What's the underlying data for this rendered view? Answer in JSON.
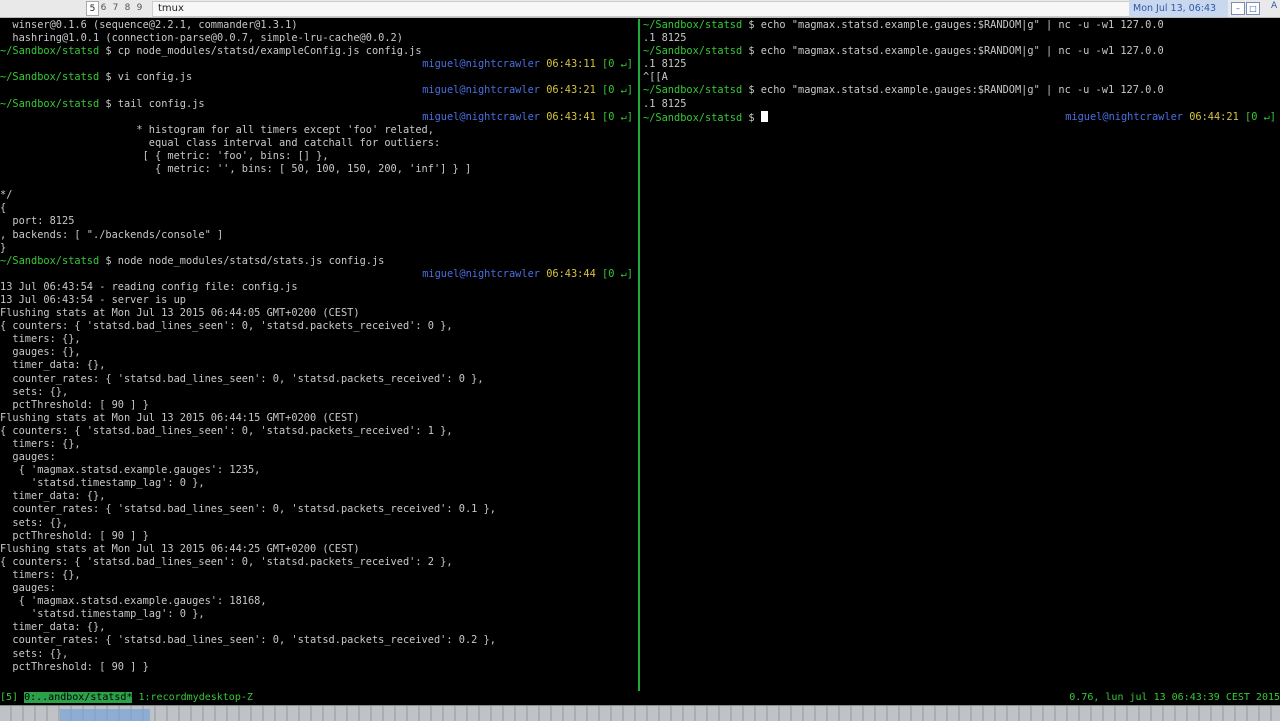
{
  "topbar": {
    "workspaces": [
      "5",
      "6",
      "7",
      "8",
      "9"
    ],
    "window_title": "tmux",
    "clock": "Mon Jul 13, 06:43",
    "trailing": "A"
  },
  "left_pane": [
    {
      "t": "  winser@0.1.6 (sequence@2.2.1, commander@1.3.1)"
    },
    {
      "t": "  hashring@1.0.1 (connection-parse@0.0.7, simple-lru-cache@0.0.2)"
    },
    {
      "cwd": "~/Sandbox/statsd",
      "t": " $ cp node_modules/statsd/exampleConfig.js config.js"
    },
    {
      "t": "",
      "user": "miguel@nightcrawler",
      "time": "06:43:11",
      "stat": "[0 ↵]"
    },
    {
      "cwd": "~/Sandbox/statsd",
      "t": " $ vi config.js"
    },
    {
      "t": "",
      "user": "miguel@nightcrawler",
      "time": "06:43:21",
      "stat": "[0 ↵]"
    },
    {
      "cwd": "~/Sandbox/statsd",
      "t": " $ tail config.js"
    },
    {
      "t": "",
      "user": "miguel@nightcrawler",
      "time": "06:43:41",
      "stat": "[0 ↵]"
    },
    {
      "t": "                      * histogram for all timers except 'foo' related,"
    },
    {
      "t": "                        equal class interval and catchall for outliers:"
    },
    {
      "t": "                       [ { metric: 'foo', bins: [] },"
    },
    {
      "t": "                         { metric: '', bins: [ 50, 100, 150, 200, 'inf'] } ]"
    },
    {
      "t": ""
    },
    {
      "t": "*/"
    },
    {
      "t": "{"
    },
    {
      "t": "  port: 8125"
    },
    {
      "t": ", backends: [ \"./backends/console\" ]"
    },
    {
      "t": "}"
    },
    {
      "cwd": "~/Sandbox/statsd",
      "t": " $ node node_modules/statsd/stats.js config.js"
    },
    {
      "t": "",
      "user": "miguel@nightcrawler",
      "time": "06:43:44",
      "stat": "[0 ↵]"
    },
    {
      "t": "13 Jul 06:43:54 - reading config file: config.js"
    },
    {
      "t": "13 Jul 06:43:54 - server is up"
    },
    {
      "t": "Flushing stats at Mon Jul 13 2015 06:44:05 GMT+0200 (CEST)"
    },
    {
      "t": "{ counters: { 'statsd.bad_lines_seen': 0, 'statsd.packets_received': 0 },"
    },
    {
      "t": "  timers: {},"
    },
    {
      "t": "  gauges: {},"
    },
    {
      "t": "  timer_data: {},"
    },
    {
      "t": "  counter_rates: { 'statsd.bad_lines_seen': 0, 'statsd.packets_received': 0 },"
    },
    {
      "t": "  sets: {},"
    },
    {
      "t": "  pctThreshold: [ 90 ] }"
    },
    {
      "t": "Flushing stats at Mon Jul 13 2015 06:44:15 GMT+0200 (CEST)"
    },
    {
      "t": "{ counters: { 'statsd.bad_lines_seen': 0, 'statsd.packets_received': 1 },"
    },
    {
      "t": "  timers: {},"
    },
    {
      "t": "  gauges:"
    },
    {
      "t": "   { 'magmax.statsd.example.gauges': 1235,"
    },
    {
      "t": "     'statsd.timestamp_lag': 0 },"
    },
    {
      "t": "  timer_data: {},"
    },
    {
      "t": "  counter_rates: { 'statsd.bad_lines_seen': 0, 'statsd.packets_received': 0.1 },"
    },
    {
      "t": "  sets: {},"
    },
    {
      "t": "  pctThreshold: [ 90 ] }"
    },
    {
      "t": "Flushing stats at Mon Jul 13 2015 06:44:25 GMT+0200 (CEST)"
    },
    {
      "t": "{ counters: { 'statsd.bad_lines_seen': 0, 'statsd.packets_received': 2 },"
    },
    {
      "t": "  timers: {},"
    },
    {
      "t": "  gauges:"
    },
    {
      "t": "   { 'magmax.statsd.example.gauges': 18168,"
    },
    {
      "t": "     'statsd.timestamp_lag': 0 },"
    },
    {
      "t": "  timer_data: {},"
    },
    {
      "t": "  counter_rates: { 'statsd.bad_lines_seen': 0, 'statsd.packets_received': 0.2 },"
    },
    {
      "t": "  sets: {},"
    },
    {
      "t": "  pctThreshold: [ 90 ] }"
    }
  ],
  "right_pane": [
    {
      "cwd": "~/Sandbox/statsd",
      "t": " $ echo \"magmax.statsd.example.gauges:$RANDOM|g\" | nc -u -w1 127.0.0"
    },
    {
      "t": ".1 8125"
    },
    {
      "cwd": "~/Sandbox/statsd",
      "t": " $ echo \"magmax.statsd.example.gauges:$RANDOM|g\" | nc -u -w1 127.0.0"
    },
    {
      "t": ".1 8125"
    },
    {
      "t": "^[[A"
    },
    {
      "cwd": "~/Sandbox/statsd",
      "t": " $ echo \"magmax.statsd.example.gauges:$RANDOM|g\" | nc -u -w1 127.0.0"
    },
    {
      "t": ".1 8125"
    },
    {
      "cwd": "~/Sandbox/statsd",
      "t": " $ ",
      "cursor": true,
      "user": "miguel@nightcrawler",
      "time": "06:44:21",
      "stat": "[0 ↵]"
    }
  ],
  "statusbar": {
    "session": "[5] ",
    "active_window": "0:..andbox/statsd*",
    "other_window": " 1:recordmydesktop-Z",
    "right": "0.76, lun jul 13 06:43:39 CEST 2015"
  }
}
